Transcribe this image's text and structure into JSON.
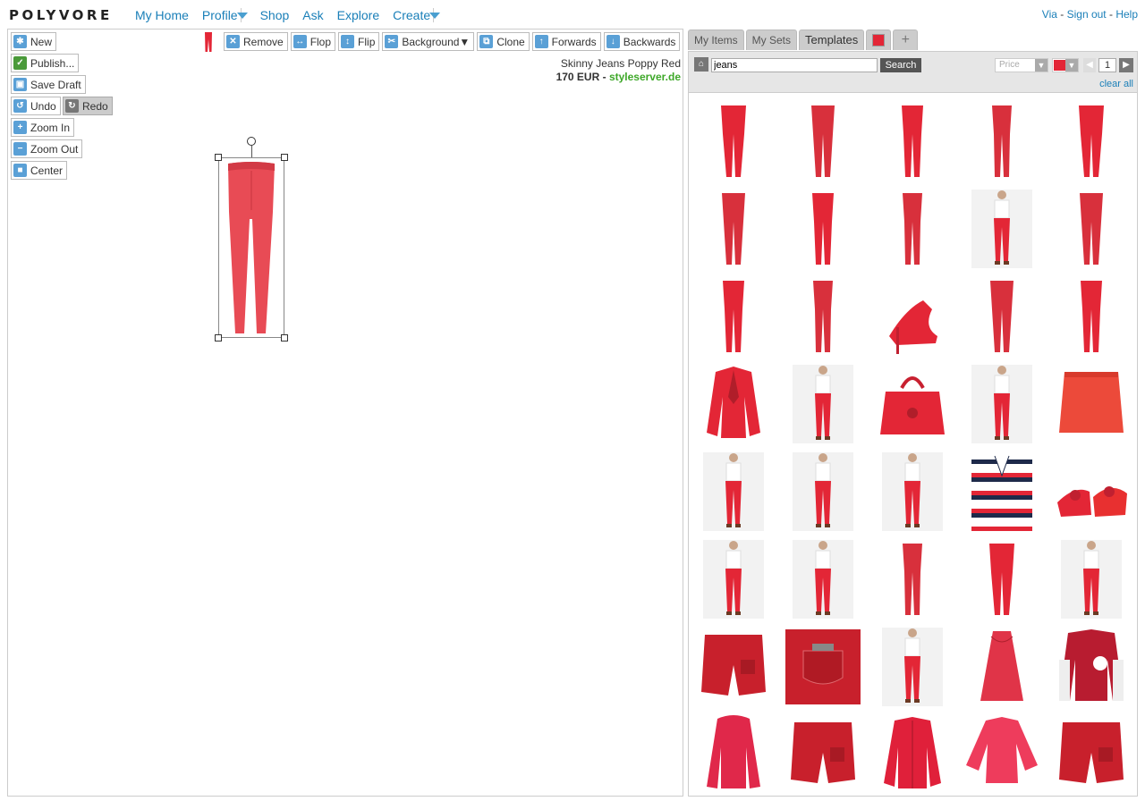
{
  "brand": "POLYVORE",
  "nav": {
    "items": [
      {
        "label": "My Home",
        "dropdown": false
      },
      {
        "label": "Profile",
        "dropdown": true
      },
      {
        "label": "Shop",
        "dropdown": false
      },
      {
        "label": "Ask",
        "dropdown": false
      },
      {
        "label": "Explore",
        "dropdown": false
      },
      {
        "label": "Create",
        "dropdown": true
      }
    ],
    "right": {
      "via": "Via",
      "signout": "Sign out",
      "help": "Help",
      "sep": " - "
    }
  },
  "editor": {
    "side_tools": [
      {
        "label": "New",
        "icon": "new-icon",
        "glyph": "✱",
        "active": false
      },
      {
        "label": "Publish...",
        "icon": "check-icon",
        "glyph": "✓",
        "active": false
      },
      {
        "label": "Save Draft",
        "icon": "save-icon",
        "glyph": "▣",
        "active": false
      },
      {
        "label": "Undo",
        "icon": "undo-icon",
        "glyph": "↺",
        "active": false
      },
      {
        "label": "Redo",
        "icon": "redo-icon",
        "glyph": "↻",
        "active": true
      },
      {
        "label": "Zoom In",
        "icon": "zoom-in-icon",
        "glyph": "+",
        "active": false
      },
      {
        "label": "Zoom Out",
        "icon": "zoom-out-icon",
        "glyph": "−",
        "active": false
      },
      {
        "label": "Center",
        "icon": "center-icon",
        "glyph": "■",
        "active": false
      }
    ],
    "item_tools": [
      {
        "label": "Remove",
        "icon": "remove-icon",
        "glyph": "✕"
      },
      {
        "label": "Flop",
        "icon": "flop-icon",
        "glyph": "↔"
      },
      {
        "label": "Flip",
        "icon": "flip-icon",
        "glyph": "↕"
      },
      {
        "label": "Background",
        "icon": "scissors-icon",
        "glyph": "✂",
        "suffix": " ▼"
      },
      {
        "label": "Clone",
        "icon": "clone-icon",
        "glyph": "⧉"
      },
      {
        "label": "Forwards",
        "icon": "arrow-up-icon",
        "glyph": "↑"
      },
      {
        "label": "Backwards",
        "icon": "arrow-down-icon",
        "glyph": "↓"
      }
    ],
    "selected_item": {
      "name": "Skinny Jeans Poppy Red",
      "price": "170 EUR",
      "separator": " - ",
      "store": "styleserver.de"
    }
  },
  "panel": {
    "tabs": [
      {
        "label": "My Items",
        "kind": "text"
      },
      {
        "label": "My Sets",
        "kind": "text"
      },
      {
        "label": "Templates",
        "kind": "text"
      },
      {
        "label": "",
        "kind": "color"
      },
      {
        "label": "+",
        "kind": "plus"
      }
    ],
    "search": {
      "value": "jeans",
      "button": "Search"
    },
    "filters": {
      "price_placeholder": "Price",
      "color": "#e32636",
      "page": "1"
    },
    "clear_all": "clear all",
    "items": [
      "pants",
      "pants",
      "pants",
      "pants",
      "pants",
      "pants",
      "pants",
      "pants",
      "model-pants",
      "pants",
      "pants",
      "pants",
      "heels",
      "pants",
      "pants",
      "blazer",
      "model-pants",
      "bag",
      "model-pants",
      "skirt",
      "model-pants",
      "model-pants",
      "model-pants",
      "striped-jacket",
      "sandals",
      "model-pants",
      "model-pants",
      "pants",
      "pants",
      "model-pants",
      "shorts",
      "pocket",
      "model-pants",
      "dress",
      "varsity",
      "hoodie",
      "shorts",
      "jacket",
      "blouse",
      "shorts"
    ]
  },
  "colors": {
    "accent_red": "#e32636",
    "link": "#1a7fb8",
    "store_green": "#3ea829"
  }
}
